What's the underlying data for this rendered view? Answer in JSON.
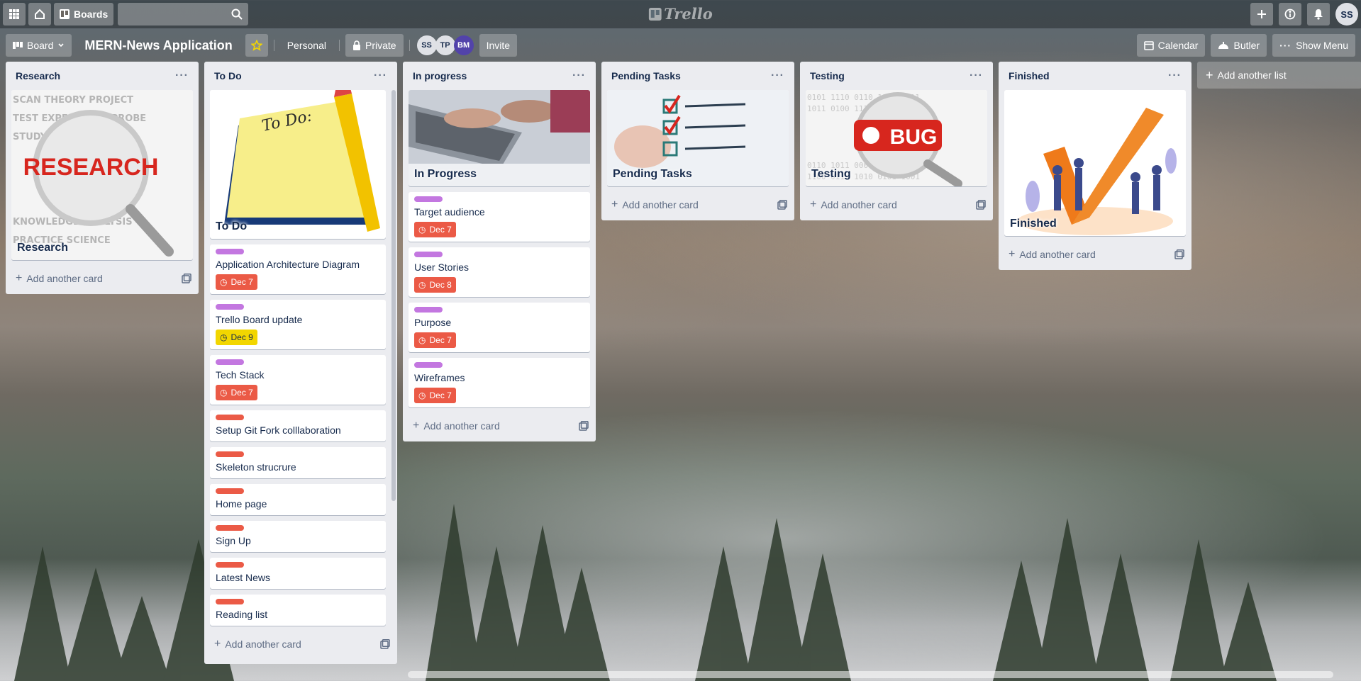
{
  "app": {
    "logo": "Trello",
    "boards_label": "Boards",
    "search_placeholder": "",
    "user_initials": "SS"
  },
  "board": {
    "view_label": "Board",
    "title": "MERN-News Application",
    "workspace": "Personal",
    "visibility": "Private",
    "members": [
      "SS",
      "TP",
      "BM"
    ],
    "invite_label": "Invite",
    "calendar_label": "Calendar",
    "butler_label": "Butler",
    "menu_label": "Show Menu"
  },
  "colors": {
    "label_purple": "#c377e0",
    "label_red": "#eb5a46",
    "due_red": "#eb5a46",
    "due_yellow": "#f2d600"
  },
  "add_card_label": "Add another card",
  "add_list_label": "Add another list",
  "lists": {
    "research": {
      "title": "Research",
      "cover": {
        "title": "Research",
        "art_text": "RESEARCH"
      }
    },
    "todo": {
      "title": "To Do",
      "cover": {
        "title": "To Do",
        "art_text": "To Do:"
      },
      "cards": [
        {
          "title": "Application Architecture Diagram",
          "label": "purple",
          "due": "Dec 7",
          "due_color": "red"
        },
        {
          "title": "Trello Board update",
          "label": "purple",
          "due": "Dec 9",
          "due_color": "yellow"
        },
        {
          "title": "Tech Stack",
          "label": "purple",
          "due": "Dec 7",
          "due_color": "red"
        },
        {
          "title": "Setup Git Fork colllaboration",
          "label": "red"
        },
        {
          "title": "Skeleton strucrure",
          "label": "red"
        },
        {
          "title": "Home page",
          "label": "red"
        },
        {
          "title": "Sign Up",
          "label": "red"
        },
        {
          "title": "Latest News",
          "label": "red"
        },
        {
          "title": "Reading list",
          "label": "red"
        }
      ]
    },
    "inprogress": {
      "title": "In progress",
      "cover": {
        "title": "In Progress"
      },
      "cards": [
        {
          "title": "Target audience",
          "label": "purple",
          "due": "Dec 7",
          "due_color": "red"
        },
        {
          "title": "User Stories",
          "label": "purple",
          "due": "Dec 8",
          "due_color": "red"
        },
        {
          "title": "Purpose",
          "label": "purple",
          "due": "Dec 7",
          "due_color": "red"
        },
        {
          "title": "Wireframes",
          "label": "purple",
          "due": "Dec 7",
          "due_color": "red"
        }
      ]
    },
    "pending": {
      "title": "Pending Tasks",
      "cover": {
        "title": "Pending Tasks"
      }
    },
    "testing": {
      "title": "Testing",
      "cover": {
        "title": "Testing",
        "art_text": "BUG"
      }
    },
    "finished": {
      "title": "Finished",
      "cover": {
        "title": "Finished"
      }
    }
  }
}
